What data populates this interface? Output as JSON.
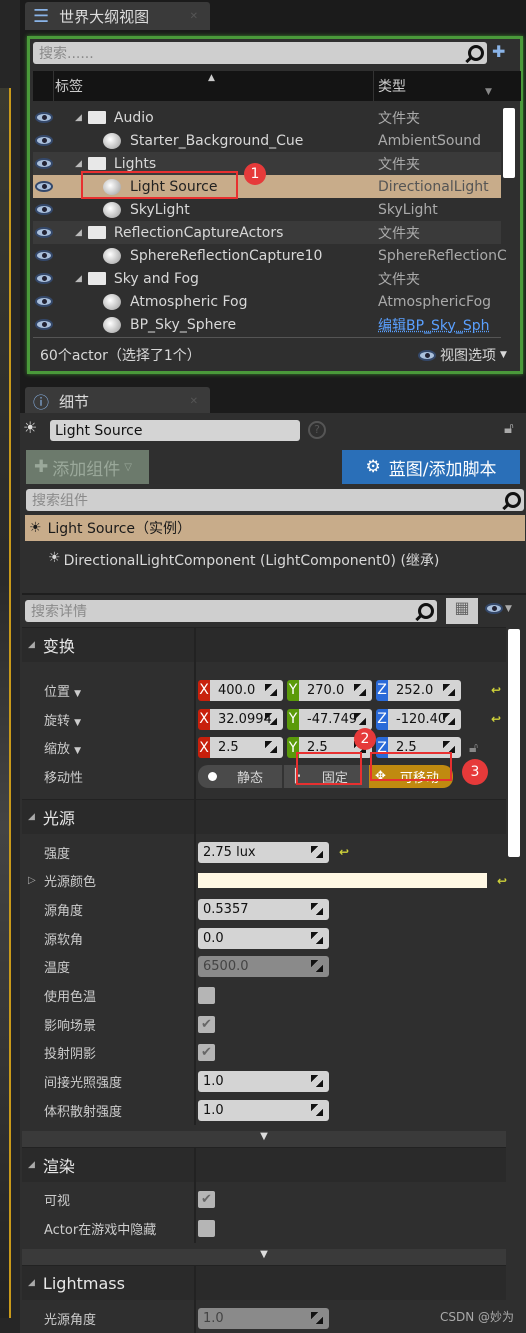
{
  "outliner": {
    "tab_title": "世界大纲视图",
    "search_placeholder": "搜索......",
    "col_label": "标签",
    "col_type": "类型",
    "rows": [
      {
        "label": "Audio",
        "type": "文件夹",
        "kind": "folder",
        "indent": 1,
        "alt": false
      },
      {
        "label": "Starter_Background_Cue",
        "type": "AmbientSound",
        "kind": "actor",
        "indent": 2,
        "alt": false
      },
      {
        "label": "Lights",
        "type": "文件夹",
        "kind": "folder",
        "indent": 1,
        "alt": true
      },
      {
        "label": "Light Source",
        "type": "DirectionalLight",
        "kind": "actor",
        "indent": 2,
        "selected": true
      },
      {
        "label": "SkyLight",
        "type": "SkyLight",
        "kind": "actor",
        "indent": 2
      },
      {
        "label": "ReflectionCaptureActors",
        "type": "文件夹",
        "kind": "folder",
        "indent": 1,
        "alt": true
      },
      {
        "label": "SphereReflectionCapture10",
        "type": "SphereReflectionC",
        "kind": "actor",
        "indent": 2
      },
      {
        "label": "Sky and Fog",
        "type": "文件夹",
        "kind": "folder",
        "indent": 1
      },
      {
        "label": "Atmospheric Fog",
        "type": "AtmosphericFog",
        "kind": "actor",
        "indent": 2
      },
      {
        "label": "BP_Sky_Sphere",
        "type": "编辑BP_Sky_Sph",
        "kind": "actor",
        "indent": 2,
        "link": true
      }
    ],
    "status": "60个actor（选择了1个）",
    "view_options": "视图选项"
  },
  "details": {
    "tab_title": "细节",
    "actor_name": "Light Source",
    "add_component": "添加组件",
    "blueprint_button": "蓝图/添加脚本",
    "search_components_placeholder": "搜索组件",
    "instance_row": "Light Source（实例）",
    "component_row": "DirectionalLightComponent (LightComponent0) (继承)",
    "search_details_placeholder": "搜索详情",
    "transform": {
      "title": "变换",
      "location_label": "位置",
      "rotation_label": "旋转",
      "scale_label": "缩放",
      "mobility_label": "移动性",
      "location": [
        "400.0",
        "270.0",
        "252.0"
      ],
      "rotation": [
        "32.0994",
        "-47.749",
        "-120.40"
      ],
      "scale": [
        "2.5",
        "2.5",
        "2.5"
      ],
      "mobility_options": [
        "静态",
        "固定",
        "可移动"
      ],
      "mobility_selected": "可移动"
    },
    "light": {
      "title": "光源",
      "props": [
        {
          "label": "强度",
          "kind": "num",
          "value": "2.75 lux",
          "reset": true
        },
        {
          "label": "光源颜色",
          "kind": "color",
          "value": "#fff8e4",
          "reset": true
        },
        {
          "label": "源角度",
          "kind": "num",
          "value": "0.5357"
        },
        {
          "label": "源软角",
          "kind": "num",
          "value": "0.0"
        },
        {
          "label": "温度",
          "kind": "num",
          "value": "6500.0",
          "disabled": true
        },
        {
          "label": "使用色温",
          "kind": "check",
          "checked": false
        },
        {
          "label": "影响场景",
          "kind": "check",
          "checked": true
        },
        {
          "label": "投射阴影",
          "kind": "check",
          "checked": true
        },
        {
          "label": "间接光照强度",
          "kind": "num",
          "value": "1.0"
        },
        {
          "label": "体积散射强度",
          "kind": "num",
          "value": "1.0"
        }
      ]
    },
    "rendering": {
      "title": "渲染",
      "props": [
        {
          "label": "可视",
          "kind": "check",
          "checked": true
        },
        {
          "label": "Actor在游戏中隐藏",
          "kind": "check",
          "checked": false
        }
      ]
    },
    "lightmass": {
      "title": "Lightmass",
      "props": [
        {
          "label": "光源角度",
          "kind": "num",
          "value": "1.0",
          "disabled": true
        }
      ]
    }
  },
  "annotations": [
    "1",
    "2",
    "3"
  ],
  "watermark": "CSDN @妙为",
  "colors": {
    "selection": "#c8ac8a",
    "mobile_active": "#c08a10",
    "blueprint": "#2a6fb8",
    "outliner_border": "#4a9a3a"
  }
}
